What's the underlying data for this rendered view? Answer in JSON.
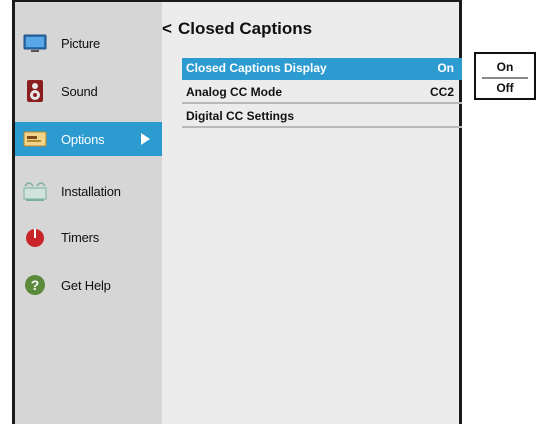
{
  "sidebar": {
    "items": [
      {
        "label": "Picture",
        "icon": "tv-screen-icon"
      },
      {
        "label": "Sound",
        "icon": "speaker-icon"
      },
      {
        "label": "Options",
        "icon": "options-panel-icon",
        "active": true
      },
      {
        "label": "Installation",
        "icon": "antenna-satellite-icon"
      },
      {
        "label": "Timers",
        "icon": "power-timer-icon"
      },
      {
        "label": "Get Help",
        "icon": "help-question-icon"
      }
    ]
  },
  "main": {
    "back_glyph": "<",
    "title": "Closed Captions",
    "rows": [
      {
        "label": "Closed Captions Display",
        "value": "On",
        "selected": true
      },
      {
        "label": "Analog CC Mode",
        "value": "CC2"
      },
      {
        "label": "Digital CC Settings",
        "value": ""
      }
    ]
  },
  "popup": {
    "options": [
      "On",
      "Off"
    ],
    "selected": "On"
  },
  "colors": {
    "accent": "#2c9bd0",
    "sidebar_bg": "#d6d6d6",
    "main_bg": "#ececec"
  }
}
